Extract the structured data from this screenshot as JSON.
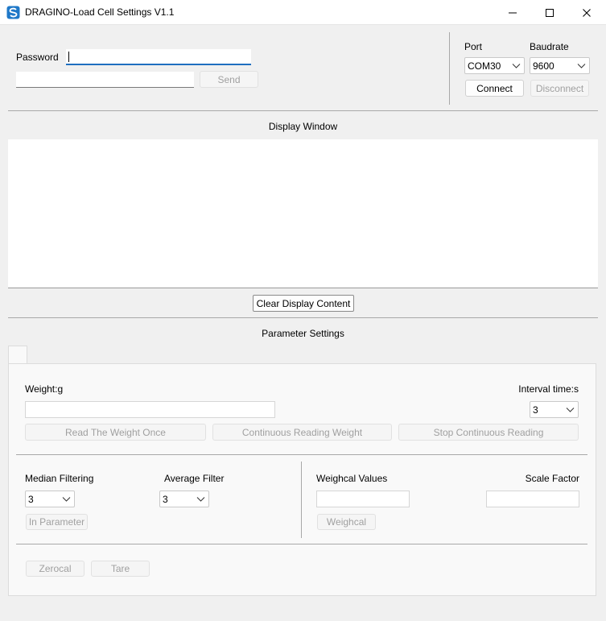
{
  "window": {
    "title": "DRAGINO-Load Cell Settings V1.1",
    "icon": "dragino-logo-icon",
    "brand_color": "#1f78c8",
    "controls": [
      "minimize-icon",
      "maximize-icon",
      "close-icon"
    ]
  },
  "password": {
    "label": "Password",
    "value": ""
  },
  "command": {
    "value": "",
    "send_label": "Send"
  },
  "connection": {
    "port_label": "Port",
    "port_value": "COM30",
    "baudrate_label": "Baudrate",
    "baudrate_value": "9600",
    "connect_label": "Connect",
    "disconnect_label": "Disconnect"
  },
  "display": {
    "title": "Display Window",
    "content": "",
    "clear_label": "Clear Display Content"
  },
  "parameters": {
    "title": "Parameter Settings",
    "weight_label": "Weight:g",
    "weight_value": "",
    "interval_label": "Interval time:s",
    "interval_value": "3",
    "read_once_label": "Read The Weight Once",
    "continuous_label": "Continuous Reading Weight",
    "stop_label": "Stop Continuous Reading",
    "median_label": "Median Filtering",
    "median_value": "3",
    "average_label": "Average Filter",
    "average_value": "3",
    "in_parameter_label": "In Parameter",
    "weighcal_values_label": "Weighcal Values",
    "weighcal_value": "",
    "scale_factor_label": "Scale Factor",
    "scale_factor_value": "",
    "weighcal_label": "Weighcal",
    "zerocal_label": "Zerocal",
    "tare_label": "Tare"
  }
}
